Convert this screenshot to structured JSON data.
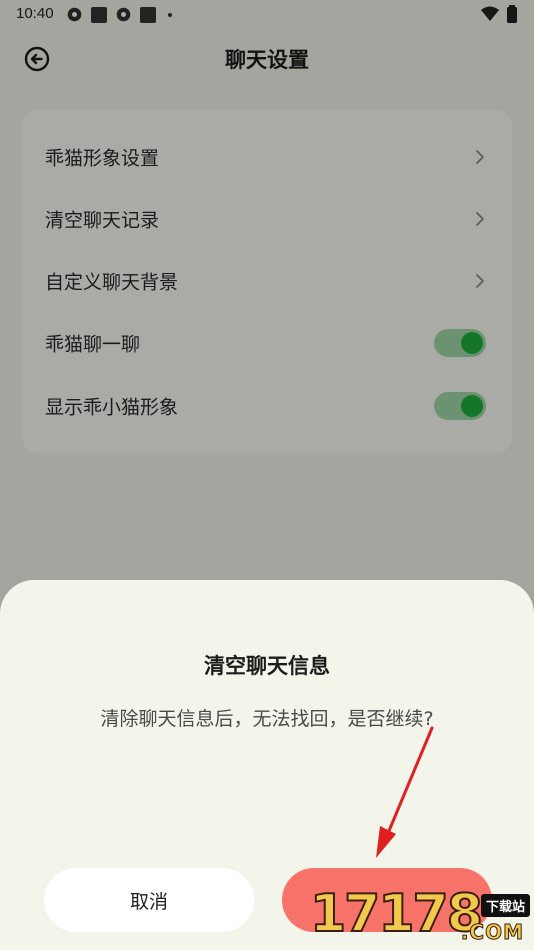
{
  "status_bar": {
    "time": "10:40"
  },
  "header": {
    "title": "聊天设置"
  },
  "settings": {
    "items": [
      {
        "label": "乖猫形象设置",
        "type": "link"
      },
      {
        "label": "清空聊天记录",
        "type": "link"
      },
      {
        "label": "自定义聊天背景",
        "type": "link"
      },
      {
        "label": "乖猫聊一聊",
        "type": "toggle",
        "on": true
      },
      {
        "label": "显示乖小猫形象",
        "type": "toggle",
        "on": true
      }
    ]
  },
  "dialog": {
    "title": "清空聊天信息",
    "message": "清除聊天信息后，无法找回，是否继续?",
    "cancel_label": "取消",
    "confirm_label": ""
  },
  "watermark": {
    "main": "17178",
    "tag": "下载站",
    "suffix": ".COM"
  },
  "colors": {
    "accent": "#f7736a",
    "toggle_on": "#1fae3a",
    "background": "#f3f4ea",
    "annotation_arrow": "#e02020"
  }
}
